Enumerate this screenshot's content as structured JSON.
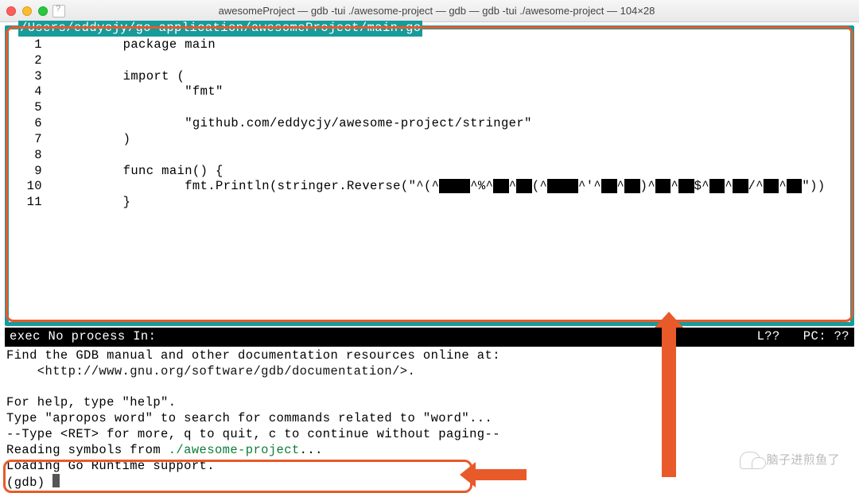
{
  "window": {
    "title": "awesomeProject — gdb -tui ./awesome-project — gdb — gdb -tui ./awesome-project — 104×28"
  },
  "source": {
    "path": "/Users/eddycjy/go-application/awesomeProject/main.go",
    "lines": [
      {
        "n": "1",
        "t": "        package main"
      },
      {
        "n": "2",
        "t": ""
      },
      {
        "n": "3",
        "t": "        import ("
      },
      {
        "n": "4",
        "t": "                \"fmt\""
      },
      {
        "n": "5",
        "t": ""
      },
      {
        "n": "6",
        "t": "                \"github.com/eddycjy/awesome-project/stringer\""
      },
      {
        "n": "7",
        "t": "        )"
      },
      {
        "n": "8",
        "t": ""
      },
      {
        "n": "9",
        "t": "        func main() {"
      },
      {
        "n": "10",
        "t": "                fmt.Println(stringer.Reverse(\"^(^▄▄^%^▄^▄(^▄▄^'^▄^▄)^▄^▄$^▄^▄/^▄^▄\"))"
      },
      {
        "n": "11",
        "t": "        }"
      }
    ]
  },
  "status": {
    "left": "exec No process In:",
    "right": "L??   PC: ??"
  },
  "gdb": {
    "l1": "Find the GDB manual and other documentation resources online at:",
    "l2": "    <http://www.gnu.org/software/gdb/documentation/>.",
    "l3": "",
    "l4": "For help, type \"help\".",
    "l5": "Type \"apropos word\" to search for commands related to \"word\"...",
    "l6": "--Type <RET> for more, q to quit, c to continue without paging--",
    "sym1a": "Reading symbols from ",
    "sym1b": "./awesome-project",
    "sym1c": "...",
    "sym2": "Loading Go Runtime support.",
    "prompt": "(gdb) "
  },
  "watermark": "脑子进煎鱼了"
}
